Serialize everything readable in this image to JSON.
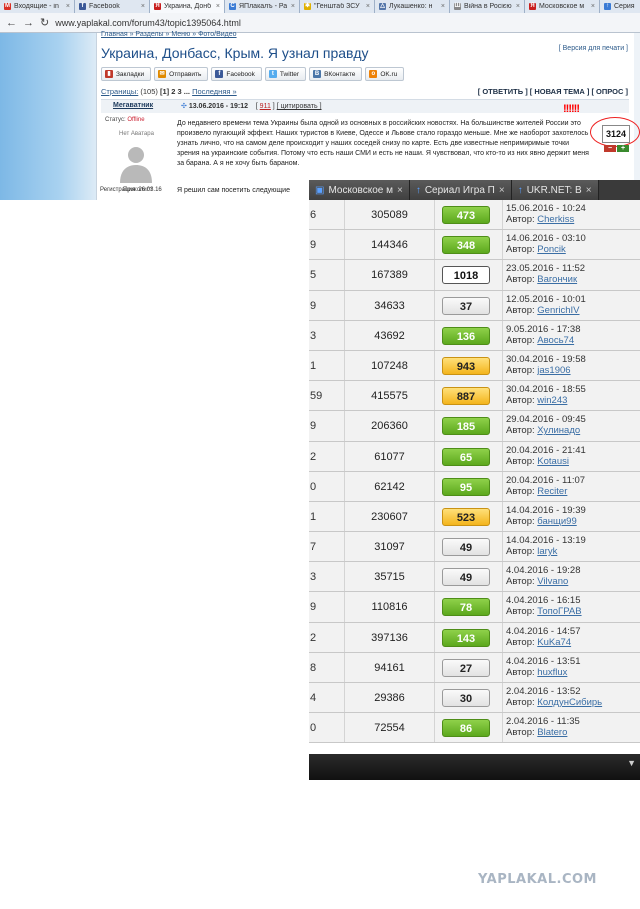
{
  "browser": {
    "tabs": [
      {
        "label": "Входящие - in",
        "icon_color": "#d93025",
        "icon": "M"
      },
      {
        "label": "Facebook",
        "icon_color": "#3b5998",
        "icon": "f"
      },
      {
        "label": "Украина, Донб",
        "icon_color": "#c81e1e",
        "icon": "Я",
        "active": true
      },
      {
        "label": "ЯПлакалъ - Ра",
        "icon_color": "#3a7bd5",
        "icon": "C"
      },
      {
        "label": "\"Генштаб ЗСУ",
        "icon_color": "#e0b000",
        "icon": "✱"
      },
      {
        "label": "Лукашенко: н",
        "icon_color": "#5577aa",
        "icon": "△"
      },
      {
        "label": "Війна в Росією",
        "icon_color": "#888888",
        "icon": "Ш"
      },
      {
        "label": "Московское м",
        "icon_color": "#c81e1e",
        "icon": "Я"
      },
      {
        "label": "Серия",
        "icon_color": "#3a7bd5",
        "icon": "↑"
      }
    ],
    "url": "www.yaplakal.com/forum43/topic1395064.html"
  },
  "topic": {
    "breadcrumb": "Главная » Разделы » Меню » Фото/Видео",
    "title": "Украина, Донбасс, Крым. Я узнал правду",
    "print_version": "[ Версия для печати ]",
    "share_buttons": [
      {
        "label": "Закладки",
        "icon_color": "#c0392b",
        "icon": "▮"
      },
      {
        "label": "Отправить",
        "icon_color": "#e08a00",
        "icon": "✉"
      },
      {
        "label": "Facebook",
        "icon_color": "#3b5998",
        "icon": "f"
      },
      {
        "label": "Twitter",
        "icon_color": "#55acee",
        "icon": "t"
      },
      {
        "label": "ВКонтакте",
        "icon_color": "#4a76a8",
        "icon": "B"
      },
      {
        "label": "OK.ru",
        "icon_color": "#ee8208",
        "icon": "o"
      }
    ],
    "actions": "[ ОТВЕТИТЬ ] [ НОВАЯ ТЕМА ] [ ОПРОС ]",
    "pages_prefix": "Страницы:",
    "pages_count": "(105)",
    "pages_list": "[1] 2 3 ...",
    "pages_last": "Последняя »",
    "post": {
      "author": "Мегаватник",
      "date": "13.06.2016 - 19:12",
      "number": "911",
      "quote": "[ цитировать ]",
      "exclaim": "!!!!!!",
      "rating": "3124",
      "rate_minus": "−",
      "rate_plus": "+",
      "status_label": "Статус:",
      "status_value": "Offline",
      "no_avatar": "Нет Аватара",
      "rank": "Приколист",
      "registration": "Регистрация: 26.03.16",
      "body": "До недавнего времени тема Украины была одной из основных в российских новостях. На большинстве жителей России это произвело пугающий эффект. Наших туристов в Киеве, Одессе и Львове стало гораздо меньше. Мне же наоборот захотелось узнать лично, что на самом деле происходит у наших соседей снизу по карте. Есть две известные непримиримые точки зрения на украинские события. Потому что есть наши СМИ и есть не наши. Я чувствовал, что кто-то из них явно держит меня за барана. А я не хочу быть бараном.",
      "body2": "Я решил сам посетить следующие"
    }
  },
  "overlay": {
    "tabs": [
      {
        "label": "Московское м",
        "icon": "▣"
      },
      {
        "label": "Сериал Игра П",
        "icon": "↑"
      },
      {
        "label": "UKR.NET: В",
        "icon": "↑"
      }
    ],
    "rows": [
      {
        "n": "6",
        "views": "305089",
        "rating": "473",
        "color": "green",
        "date": "15.06.2016 - 10:24",
        "author": "Cherkiss"
      },
      {
        "n": "9",
        "views": "144346",
        "rating": "348",
        "color": "green",
        "date": "14.06.2016 - 03:10",
        "author": "Poncik"
      },
      {
        "n": "5",
        "views": "167389",
        "rating": "1018",
        "color": "white",
        "date": "23.05.2016 - 11:52",
        "author": "Вагончик"
      },
      {
        "n": "9",
        "views": "34633",
        "rating": "37",
        "color": "gray",
        "date": "12.05.2016 - 10:01",
        "author": "GenrichIV"
      },
      {
        "n": "3",
        "views": "43692",
        "rating": "136",
        "color": "green",
        "date": "9.05.2016 - 17:38",
        "author": "Авось74"
      },
      {
        "n": "1",
        "views": "107248",
        "rating": "943",
        "color": "orange",
        "date": "30.04.2016 - 19:58",
        "author": "jas1906"
      },
      {
        "n": "59",
        "views": "415575",
        "rating": "887",
        "color": "orange",
        "date": "30.04.2016 - 18:55",
        "author": "win243"
      },
      {
        "n": "9",
        "views": "206360",
        "rating": "185",
        "color": "green",
        "date": "29.04.2016 - 09:45",
        "author": "Хулинадо"
      },
      {
        "n": "2",
        "views": "61077",
        "rating": "65",
        "color": "green",
        "date": "20.04.2016 - 21:41",
        "author": "Kotausi"
      },
      {
        "n": "0",
        "views": "62142",
        "rating": "95",
        "color": "green",
        "date": "20.04.2016 - 11:07",
        "author": "Reciter"
      },
      {
        "n": "1",
        "views": "230607",
        "rating": "523",
        "color": "orange",
        "date": "14.04.2016 - 19:39",
        "author": "банщи99"
      },
      {
        "n": "7",
        "views": "31097",
        "rating": "49",
        "color": "gray",
        "date": "14.04.2016 - 13:19",
        "author": "laryk"
      },
      {
        "n": "3",
        "views": "35715",
        "rating": "49",
        "color": "gray",
        "date": "4.04.2016 - 19:28",
        "author": "Vilvano"
      },
      {
        "n": "9",
        "views": "110816",
        "rating": "78",
        "color": "green",
        "date": "4.04.2016 - 16:15",
        "author": "ТопоГРАВ"
      },
      {
        "n": "2",
        "views": "397136",
        "rating": "143",
        "color": "green",
        "date": "4.04.2016 - 14:57",
        "author": "KuKa74"
      },
      {
        "n": "8",
        "views": "94161",
        "rating": "27",
        "color": "gray",
        "date": "4.04.2016 - 13:51",
        "author": "huxflux"
      },
      {
        "n": "4",
        "views": "29386",
        "rating": "30",
        "color": "gray",
        "date": "2.04.2016 - 13:52",
        "author": "КолдунСибирь"
      },
      {
        "n": "0",
        "views": "72554",
        "rating": "86",
        "color": "green",
        "date": "2.04.2016 - 11:35",
        "author": "Blatero"
      }
    ],
    "author_prefix": "Автор:"
  },
  "watermark": "YAPLAKAL.COM"
}
